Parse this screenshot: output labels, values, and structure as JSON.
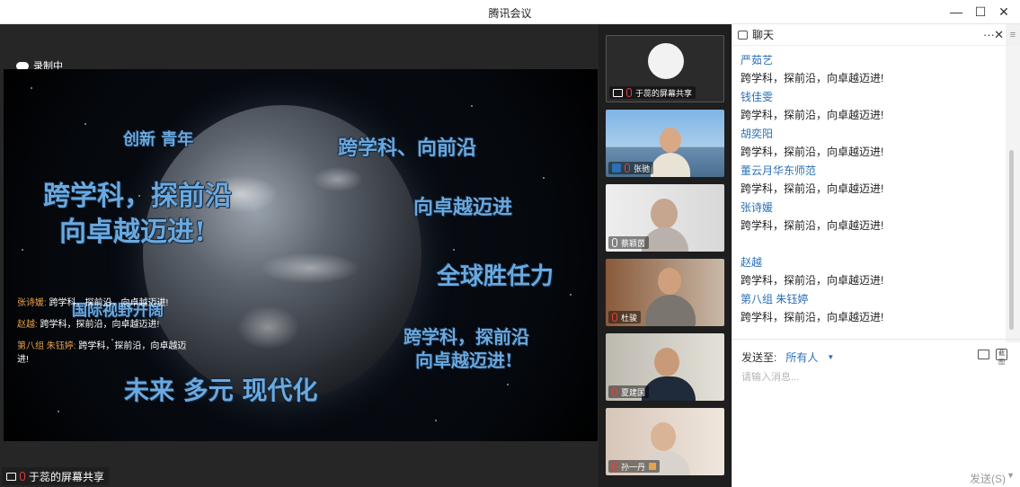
{
  "window": {
    "title": "腾讯会议",
    "minimize": "—",
    "maximize": "☐",
    "close": "✕"
  },
  "stage": {
    "recording_label": "录制中",
    "slide_texts": {
      "t1": "创新 青年",
      "t2": "跨学科、向前沿",
      "t3": "跨学科，探前沿",
      "t4": "向卓越迈进!",
      "t5": "向卓越迈进",
      "t6": "全球胜任力",
      "t7": "国际视野开阔",
      "t8": "跨学科，探前沿",
      "t9": "向卓越迈进!",
      "t10": "未来 多元 现代化"
    },
    "overlay_chat": [
      {
        "name": "张诗媛:",
        "text": "跨学科，探前沿，向卓越迈进!"
      },
      {
        "name": "赵越:",
        "text": "跨学科，探前沿，向卓越迈进!"
      },
      {
        "name": "第八组 朱钰婷:",
        "text": "跨学科，探前沿，向卓越迈进!"
      }
    ],
    "share_label": "于蕊的屏幕共享"
  },
  "participants": [
    {
      "label": "于蕊的屏幕共享"
    },
    {
      "label": "张驰"
    },
    {
      "label": "蔡颖茵"
    },
    {
      "label": "杜骏"
    },
    {
      "label": "夏建国"
    },
    {
      "label": "孙一丹"
    }
  ],
  "chat": {
    "title": "聊天",
    "more": "···",
    "close": "✕",
    "side": "≡",
    "messages": [
      {
        "who": "严茹艺",
        "text": "跨学科，探前沿，向卓越迈进!"
      },
      {
        "who": "钱佳雯",
        "text": "跨学科，探前沿，向卓越迈进!"
      },
      {
        "who": "胡奕阳",
        "text": "跨学科，探前沿，向卓越迈进!"
      },
      {
        "who": "董云月华东师范",
        "text": "跨学科，探前沿，向卓越迈进!"
      },
      {
        "who": "张诗媛",
        "text": "跨学科，探前沿，向卓越迈进!"
      },
      {
        "who": "赵越",
        "text": "跨学科，探前沿，向卓越迈进!"
      },
      {
        "who": "第八组 朱钰婷",
        "text": "跨学科，探前沿，向卓越迈进!"
      }
    ],
    "send_to_label": "发送至:",
    "send_to_value": "所有人",
    "input_placeholder": "请输入消息...",
    "send_button": "发送(S)",
    "screenshot_icon_text": "截图"
  },
  "colors": {
    "accent": "#2b6fb6",
    "slide_text": "#6aa9e0",
    "overlay_name": "#e8a04a"
  }
}
